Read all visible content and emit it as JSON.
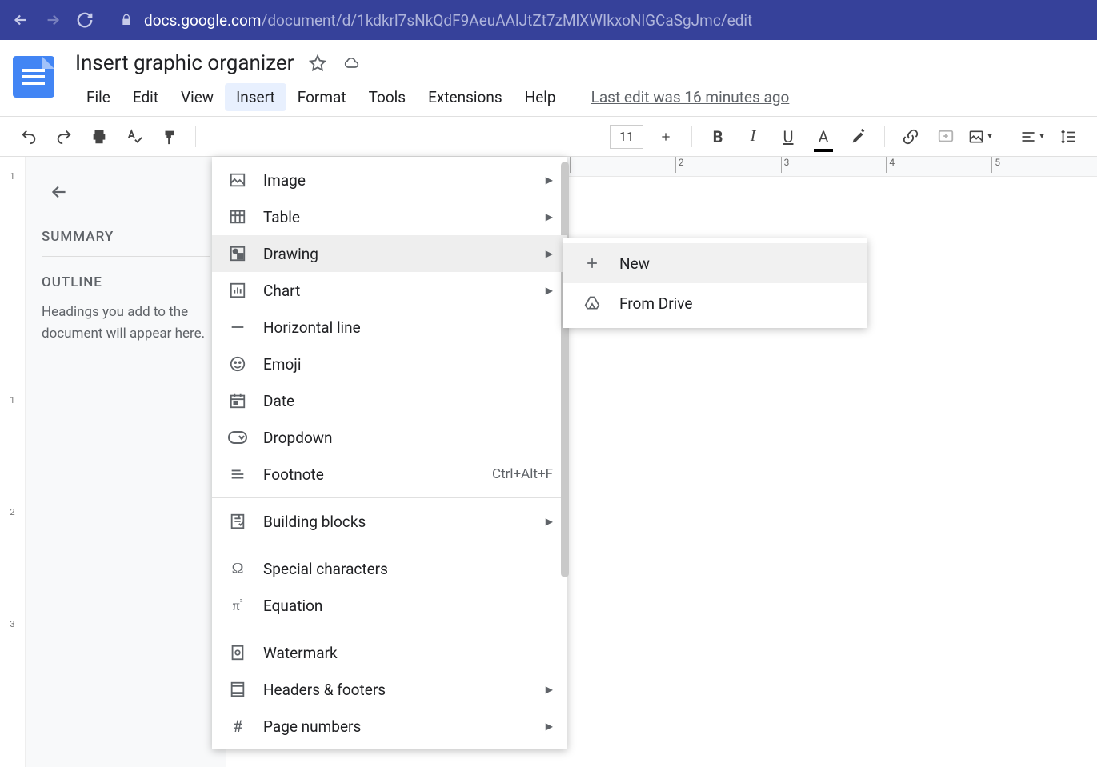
{
  "browser": {
    "url_host": "docs.google.com",
    "url_path": "/document/d/1kdkrl7sNkQdF9AeuAAlJtZt7zMlXWIkxoNlGCaSgJmc/edit"
  },
  "doc": {
    "title": "Insert graphic organizer",
    "last_edit": "Last edit was 16 minutes ago"
  },
  "menus": {
    "file": "File",
    "edit": "Edit",
    "view": "View",
    "insert": "Insert",
    "format": "Format",
    "tools": "Tools",
    "extensions": "Extensions",
    "help": "Help"
  },
  "toolbar": {
    "font_size": "11"
  },
  "outline": {
    "summary": "SUMMARY",
    "outline": "OUTLINE",
    "hint": "Headings you add to the document will appear here."
  },
  "ruler": {
    "t2": "2",
    "t3": "3",
    "t4": "4",
    "t5": "5"
  },
  "vruler": {
    "r1": "1",
    "r2": "1",
    "r3": "2",
    "r4": "3"
  },
  "insert_menu": {
    "image": "Image",
    "table": "Table",
    "drawing": "Drawing",
    "chart": "Chart",
    "hline": "Horizontal line",
    "emoji": "Emoji",
    "date": "Date",
    "dropdown": "Dropdown",
    "footnote": "Footnote",
    "footnote_shortcut": "Ctrl+Alt+F",
    "blocks": "Building blocks",
    "special": "Special characters",
    "equation": "Equation",
    "watermark": "Watermark",
    "headers": "Headers & footers",
    "pagenum": "Page numbers"
  },
  "drawing_submenu": {
    "new": "New",
    "from_drive": "From Drive"
  }
}
